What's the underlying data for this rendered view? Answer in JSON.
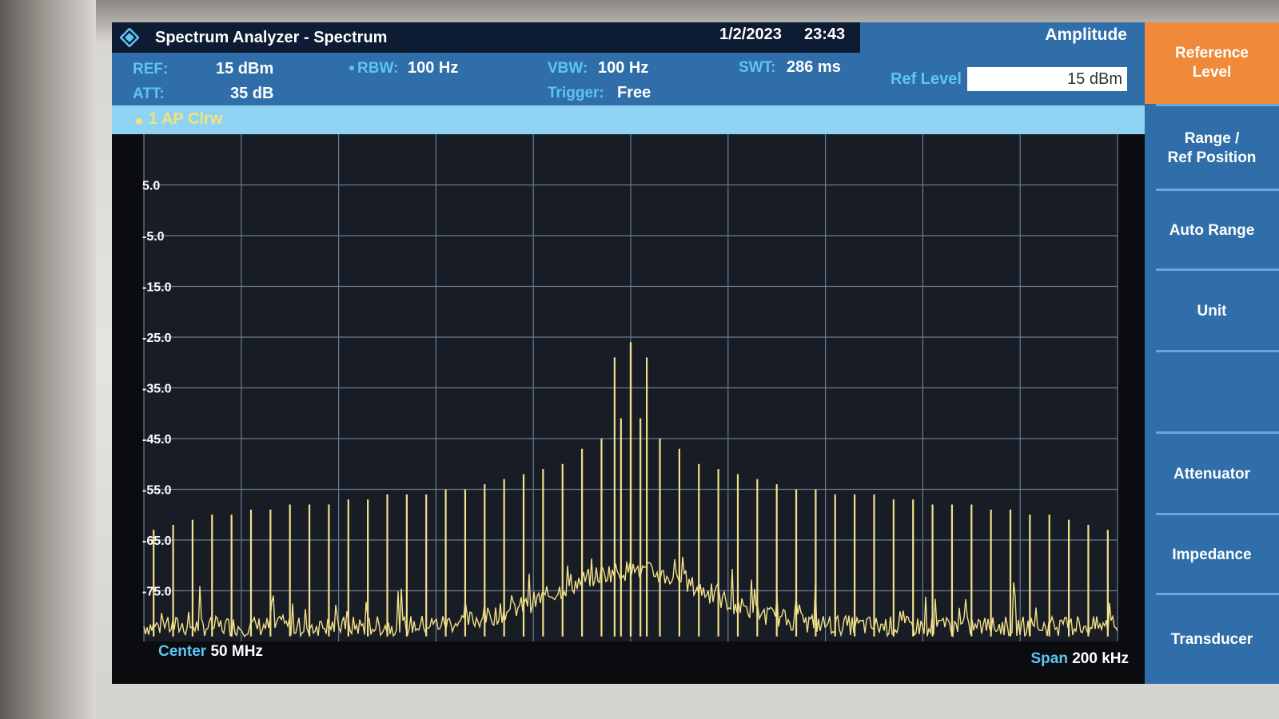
{
  "header": {
    "app_title": "Spectrum Analyzer - Spectrum",
    "date": "1/2/2023",
    "time": "23:43"
  },
  "params": {
    "ref_label": "REF:",
    "ref_value": "15 dBm",
    "att_label": "ATT:",
    "att_value": "35 dB",
    "rbw_label": "RBW:",
    "rbw_value": "100 Hz",
    "vbw_label": "VBW:",
    "vbw_value": "100 Hz",
    "trigger_label": "Trigger:",
    "trigger_value": "Free",
    "swt_label": "SWT:",
    "swt_value": "286 ms"
  },
  "amplitude_panel": {
    "title": "Amplitude",
    "ref_level_label": "Ref Level",
    "ref_level_value": "15 dBm"
  },
  "trace": {
    "label": "1 AP Clrw"
  },
  "softkeys": [
    {
      "line1": "Reference",
      "line2": "Level"
    },
    {
      "line1": "Range /",
      "line2": "Ref Position"
    },
    {
      "line1": "Auto Range",
      "line2": ""
    },
    {
      "line1": "Unit",
      "line2": ""
    },
    {
      "line1": "",
      "line2": ""
    },
    {
      "line1": "Attenuator",
      "line2": ""
    },
    {
      "line1": "Impedance",
      "line2": ""
    },
    {
      "line1": "Transducer",
      "line2": ""
    }
  ],
  "chart_data": {
    "type": "line",
    "y_tick_labels": [
      "5.0",
      "-5.0",
      "-15.0",
      "-25.0",
      "-35.0",
      "-45.0",
      "-55.0",
      "-65.0",
      "-75.0"
    ],
    "ylim": [
      -85,
      15
    ],
    "xlim": [
      -100,
      100
    ],
    "x_unit": "kHz",
    "grid": true,
    "center_label": "Center",
    "center_value": "50 MHz",
    "span_label": "Span",
    "span_value": "200 kHz",
    "trace_color": "#f2e08a",
    "noise_floor_dbm": -84,
    "spectral_lines": {
      "offsets_khz": [
        -98,
        -94,
        -90,
        -86,
        -82,
        -78,
        -74,
        -70,
        -66,
        -62,
        -58,
        -54,
        -50,
        -46,
        -42,
        -38,
        -34,
        -30,
        -26,
        -22,
        -18,
        -14,
        -10,
        -6,
        -2,
        0,
        2,
        6,
        10,
        14,
        18,
        22,
        26,
        30,
        34,
        38,
        42,
        46,
        50,
        54,
        58,
        62,
        66,
        70,
        74,
        78,
        82,
        86,
        90,
        94,
        98
      ],
      "levels_dbm": [
        -63,
        -62,
        -61,
        -60,
        -60,
        -59,
        -59,
        -58,
        -58,
        -58,
        -57,
        -57,
        -56,
        -56,
        -56,
        -55,
        -55,
        -54,
        -53,
        -52,
        -51,
        -50,
        -47,
        -45,
        -41,
        -26,
        -41,
        -45,
        -47,
        -50,
        -51,
        -52,
        -53,
        -54,
        -55,
        -55,
        -56,
        -56,
        -56,
        -57,
        -57,
        -58,
        -58,
        -58,
        -59,
        -59,
        -60,
        -60,
        -61,
        -62,
        -63
      ]
    },
    "peak_lines": {
      "offsets_khz": [
        -1.5,
        0,
        1.5
      ],
      "levels_dbm": [
        -29,
        -26,
        -29
      ]
    }
  },
  "colors": {
    "title_bar": "#0d1b33",
    "param_bar": "#2f6ea8",
    "label_cyan": "#5ec4f2",
    "softkey_active": "#f08a3a",
    "trace_band": "#8ed3f2"
  }
}
